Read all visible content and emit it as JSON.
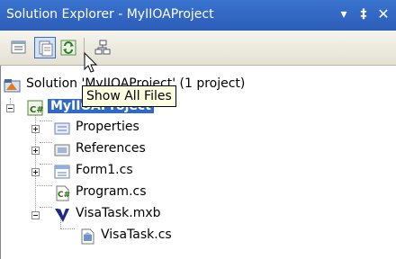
{
  "window": {
    "title": "Solution Explorer - MyIIOAProject",
    "dropdown_glyph": "▾",
    "pin_glyph": "‡",
    "close_glyph": "✕"
  },
  "toolbar": {
    "items": [
      {
        "name": "properties-tool",
        "icon": "properties-icon",
        "active": false
      },
      {
        "name": "show-all-files-tool",
        "icon": "show-all-files-icon",
        "active": true
      },
      {
        "name": "refresh-tool",
        "icon": "refresh-icon",
        "active": false
      },
      {
        "name": "class-diagram-tool",
        "icon": "class-diagram-icon",
        "active": false
      }
    ],
    "tooltip": "Show All Files"
  },
  "tree": {
    "solution_label": "Solution 'MyIIOAProject' (1 project)",
    "project_label": "MyIIOAProject",
    "items": [
      {
        "label": "Properties",
        "icon": "properties-folder-icon"
      },
      {
        "label": "References",
        "icon": "references-icon"
      },
      {
        "label": "Form1.cs",
        "icon": "form-icon"
      },
      {
        "label": "Program.cs",
        "icon": "csharp-file-icon"
      },
      {
        "label": "VisaTask.mxb",
        "icon": "mxb-icon"
      },
      {
        "label": "VisaTask.cs",
        "icon": "cs-file-icon"
      }
    ]
  },
  "colors": {
    "titlebar": "#2b5cb8",
    "selection": "#316ac5",
    "tooltip_bg": "#ffffe1"
  }
}
